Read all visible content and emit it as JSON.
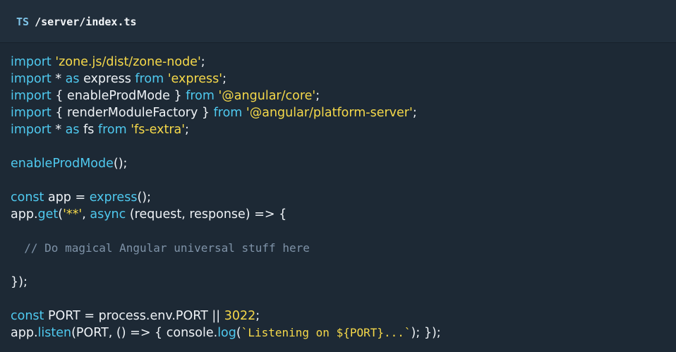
{
  "tab": {
    "language": "TS",
    "path": "/server/index.ts"
  },
  "colors": {
    "background": "#1d2935",
    "tab_bar": "#212e3b",
    "keyword": "#4fc9ef",
    "string": "#f6d94a",
    "identifier": "#eef2f6",
    "comment": "#7f93a8"
  },
  "code_lines": [
    [
      {
        "t": "kw",
        "v": "import"
      },
      {
        "t": "punc",
        "v": " "
      },
      {
        "t": "str",
        "v": "'zone.js/dist/zone-node'"
      },
      {
        "t": "punc",
        "v": ";"
      }
    ],
    [
      {
        "t": "kw",
        "v": "import"
      },
      {
        "t": "punc",
        "v": " * "
      },
      {
        "t": "kw",
        "v": "as"
      },
      {
        "t": "id",
        "v": " express "
      },
      {
        "t": "kw",
        "v": "from"
      },
      {
        "t": "punc",
        "v": " "
      },
      {
        "t": "str",
        "v": "'express'"
      },
      {
        "t": "punc",
        "v": ";"
      }
    ],
    [
      {
        "t": "kw",
        "v": "import"
      },
      {
        "t": "punc",
        "v": " { "
      },
      {
        "t": "id",
        "v": "enableProdMode"
      },
      {
        "t": "punc",
        "v": " } "
      },
      {
        "t": "kw",
        "v": "from"
      },
      {
        "t": "punc",
        "v": " "
      },
      {
        "t": "str",
        "v": "'@angular/core'"
      },
      {
        "t": "punc",
        "v": ";"
      }
    ],
    [
      {
        "t": "kw",
        "v": "import"
      },
      {
        "t": "punc",
        "v": " { "
      },
      {
        "t": "id",
        "v": "renderModuleFactory"
      },
      {
        "t": "punc",
        "v": " } "
      },
      {
        "t": "kw",
        "v": "from"
      },
      {
        "t": "punc",
        "v": " "
      },
      {
        "t": "str",
        "v": "'@angular/platform-server'"
      },
      {
        "t": "punc",
        "v": ";"
      }
    ],
    [
      {
        "t": "kw",
        "v": "import"
      },
      {
        "t": "punc",
        "v": " * "
      },
      {
        "t": "kw",
        "v": "as"
      },
      {
        "t": "id",
        "v": " fs "
      },
      {
        "t": "kw",
        "v": "from"
      },
      {
        "t": "punc",
        "v": " "
      },
      {
        "t": "str",
        "v": "'fs-extra'"
      },
      {
        "t": "punc",
        "v": ";"
      }
    ],
    [],
    [
      {
        "t": "fn",
        "v": "enableProdMode"
      },
      {
        "t": "punc",
        "v": "();"
      }
    ],
    [],
    [
      {
        "t": "kw",
        "v": "const"
      },
      {
        "t": "id",
        "v": " app = "
      },
      {
        "t": "fn",
        "v": "express"
      },
      {
        "t": "punc",
        "v": "();"
      }
    ],
    [
      {
        "t": "id",
        "v": "app."
      },
      {
        "t": "fn",
        "v": "get"
      },
      {
        "t": "punc",
        "v": "("
      },
      {
        "t": "str",
        "v": "'**'"
      },
      {
        "t": "punc",
        "v": ", "
      },
      {
        "t": "kw",
        "v": "async"
      },
      {
        "t": "id",
        "v": " (request, response) => {"
      }
    ],
    [],
    [
      {
        "t": "cmt",
        "v": "  // Do magical Angular universal stuff here"
      }
    ],
    [],
    [
      {
        "t": "punc",
        "v": "});"
      }
    ],
    [],
    [
      {
        "t": "kw",
        "v": "const"
      },
      {
        "t": "id",
        "v": " PORT = process.env.PORT || "
      },
      {
        "t": "num",
        "v": "3022"
      },
      {
        "t": "punc",
        "v": ";"
      }
    ],
    [
      {
        "t": "id",
        "v": "app."
      },
      {
        "t": "fn",
        "v": "listen"
      },
      {
        "t": "id",
        "v": "(PORT, () => { console."
      },
      {
        "t": "fn",
        "v": "log"
      },
      {
        "t": "punc",
        "v": "("
      },
      {
        "t": "tpl",
        "v": "`Listening on ${PORT}...`"
      },
      {
        "t": "punc",
        "v": "); });"
      }
    ]
  ]
}
